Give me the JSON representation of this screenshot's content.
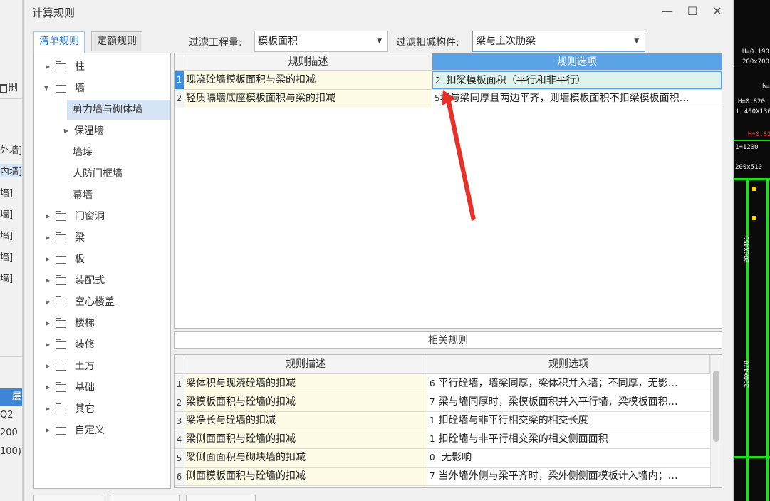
{
  "window": {
    "title": "计算规则",
    "minimize_glyph": "—",
    "maximize_glyph": "☐",
    "close_glyph": "✕"
  },
  "tabs": [
    {
      "label": "清单规则",
      "active": true
    },
    {
      "label": "定额规则",
      "active": false
    }
  ],
  "filters": {
    "quantity_label": "过滤工程量:",
    "quantity_value": "模板面积",
    "component_label": "过滤扣减构件:",
    "component_value": "梁与主次肋梁"
  },
  "tree": [
    {
      "label": "柱",
      "expanded": false,
      "folder": true,
      "level": 0
    },
    {
      "label": "墙",
      "expanded": true,
      "folder": true,
      "level": 0
    },
    {
      "label": "剪力墙与砌体墙",
      "level": 1,
      "selected": true
    },
    {
      "label": "保温墙",
      "level": 1,
      "expandable": true
    },
    {
      "label": "墙垛",
      "level": 1
    },
    {
      "label": "人防门框墙",
      "level": 1
    },
    {
      "label": "幕墙",
      "level": 1
    },
    {
      "label": "门窗洞",
      "folder": true,
      "level": 0
    },
    {
      "label": "梁",
      "folder": true,
      "level": 0
    },
    {
      "label": "板",
      "folder": true,
      "level": 0
    },
    {
      "label": "装配式",
      "folder": true,
      "level": 0
    },
    {
      "label": "空心楼盖",
      "folder": true,
      "level": 0
    },
    {
      "label": "楼梯",
      "folder": true,
      "level": 0
    },
    {
      "label": "装修",
      "folder": true,
      "level": 0
    },
    {
      "label": "土方",
      "folder": true,
      "level": 0
    },
    {
      "label": "基础",
      "folder": true,
      "level": 0
    },
    {
      "label": "其它",
      "folder": true,
      "level": 0
    },
    {
      "label": "自定义",
      "folder": true,
      "level": 0
    }
  ],
  "rules_grid": {
    "headers": [
      "规则描述",
      "规则选项"
    ],
    "rows": [
      {
        "num": "1",
        "desc": "现浇砼墙模板面积与梁的扣减",
        "code": "2",
        "option": "扣梁模板面积（平行和非平行）",
        "current": true
      },
      {
        "num": "2",
        "desc": "轻质隔墙底座模板面积与梁的扣减",
        "code": "5",
        "option": "墙与梁同厚且两边平齐，则墙模板面积不扣梁模板面积…",
        "current": false
      }
    ]
  },
  "related": {
    "title": "相关规则",
    "headers": [
      "规则描述",
      "规则选项"
    ],
    "rows": [
      {
        "num": "1",
        "desc": "梁体积与现浇砼墙的扣减",
        "code": "6",
        "option": "平行砼墙，墙梁同厚，梁体积并入墙；不同厚，无影…"
      },
      {
        "num": "2",
        "desc": "梁模板面积与砼墙的扣减",
        "code": "7",
        "option": "梁与墙同厚时，梁模板面积并入平行墙，梁模板面积…"
      },
      {
        "num": "3",
        "desc": "梁净长与砼墙的扣减",
        "code": "1",
        "option": "扣砼墙与非平行相交梁的相交长度"
      },
      {
        "num": "4",
        "desc": "梁侧面面积与砼墙的扣减",
        "code": "1",
        "option": "扣砼墙与非平行相交梁的相交侧面面积"
      },
      {
        "num": "5",
        "desc": "梁侧面面积与砌块墙的扣减",
        "code": "0",
        "option": " 无影响"
      },
      {
        "num": "6",
        "desc": "侧面模板面积与砼墙的扣减",
        "code": "7",
        "option": "当外墙外侧与梁平齐时，梁外侧侧面模板计入墙内；…"
      }
    ]
  },
  "background_app": {
    "left_items": [
      "删",
      "外墙]",
      "内墙]",
      "墙]",
      "墙]",
      "墙]",
      "墙]",
      "墙]",
      "层",
      "Q2",
      "200",
      "100)"
    ],
    "cad_labels": [
      "H=0.190",
      "200x700",
      "h=",
      "H=0.820",
      "L 400X130",
      "H=0.820",
      "1=1200",
      "200x510",
      "200X450",
      "200X470"
    ]
  },
  "colors": {
    "accent": "#5aa3e6",
    "annotation_arrow": "#e8302a",
    "desc_cell_bg": "#fdfbe6"
  }
}
